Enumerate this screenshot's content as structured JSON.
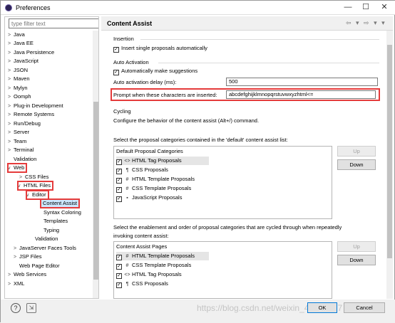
{
  "window": {
    "title": "Preferences",
    "minimize_glyph": "—",
    "maximize_glyph": "☐",
    "close_glyph": "✕"
  },
  "sidebar": {
    "filter_placeholder": "type filter text",
    "items": [
      {
        "label": "Java",
        "arrow": ">"
      },
      {
        "label": "Java EE",
        "arrow": ">"
      },
      {
        "label": "Java Persistence",
        "arrow": ">"
      },
      {
        "label": "JavaScript",
        "arrow": ">"
      },
      {
        "label": "JSON",
        "arrow": ">"
      },
      {
        "label": "Maven",
        "arrow": ">"
      },
      {
        "label": "Mylyn",
        "arrow": ">"
      },
      {
        "label": "Oomph",
        "arrow": ">"
      },
      {
        "label": "Plug-in Development",
        "arrow": ">"
      },
      {
        "label": "Remote Systems",
        "arrow": ">"
      },
      {
        "label": "Run/Debug",
        "arrow": ">"
      },
      {
        "label": "Server",
        "arrow": ">"
      },
      {
        "label": "Team",
        "arrow": ">"
      },
      {
        "label": "Terminal",
        "arrow": ">"
      },
      {
        "label": "Validation",
        "arrow": ""
      },
      {
        "label": "Web",
        "arrow": "v"
      },
      {
        "label": "CSS Files",
        "arrow": ">"
      },
      {
        "label": "HTML Files",
        "arrow": "v"
      },
      {
        "label": "Editor",
        "arrow": "v"
      },
      {
        "label": "Content Assist",
        "arrow": ""
      },
      {
        "label": "Syntax Coloring",
        "arrow": ""
      },
      {
        "label": "Templates",
        "arrow": ""
      },
      {
        "label": "Typing",
        "arrow": ""
      },
      {
        "label": "Validation",
        "arrow": ""
      },
      {
        "label": "JavaServer Faces Tools",
        "arrow": ">"
      },
      {
        "label": "JSP Files",
        "arrow": ">"
      },
      {
        "label": "Web Page Editor",
        "arrow": ""
      },
      {
        "label": "Web Services",
        "arrow": ">"
      },
      {
        "label": "XML",
        "arrow": ">"
      }
    ]
  },
  "page": {
    "title": "Content Assist",
    "nav_icons": "⇦ ▾ ⇨ ▾ ▾",
    "insertion": {
      "heading": "Insertion",
      "insert_single": "Insert single proposals automatically"
    },
    "auto_activation": {
      "heading": "Auto Activation",
      "make_suggestions": "Automatically make suggestions",
      "delay_label": "Auto activation delay (ms):",
      "delay_value": "500",
      "prompt_label": "Prompt when these characters are inserted:",
      "prompt_value": "abcdefghijklmnopqrstuvwxyzhtml<="
    },
    "cycling": {
      "heading": "Cycling",
      "description": "Configure the behavior of the content assist (Alt+/) command."
    },
    "default_list": {
      "description": "Select the proposal categories contained in the 'default' content assist list:",
      "header": "Default Proposal Categories",
      "rows": [
        {
          "icon": "<>",
          "label": "HTML Tag Proposals",
          "checked": "✓"
        },
        {
          "icon": "¶",
          "label": "CSS Proposals",
          "checked": "✓"
        },
        {
          "icon": "#",
          "label": "HTML Template Proposals",
          "checked": "✓"
        },
        {
          "icon": "#",
          "label": "CSS Template Proposals",
          "checked": "✓"
        },
        {
          "icon": "▪",
          "label": "JavaScript Proposals",
          "checked": "✓"
        }
      ],
      "up_label": "Up",
      "down_label": "Down"
    },
    "cycle_list": {
      "description_line1": "Select the enablement and order of proposal categories that are cycled through when repeatedly",
      "description_line2": "invoking content assist:",
      "header": "Content Assist Pages",
      "rows": [
        {
          "icon": "#",
          "label": "HTML Template Proposals",
          "checked": "✓"
        },
        {
          "icon": "#",
          "label": "CSS Template Proposals",
          "checked": "✓"
        },
        {
          "icon": "<>",
          "label": "HTML Tag Proposals",
          "checked": "✓"
        },
        {
          "icon": "¶",
          "label": "CSS Proposals",
          "checked": "✓"
        }
      ],
      "up_label": "Up",
      "down_label": "Down"
    }
  },
  "footer": {
    "help_glyph": "?",
    "import_glyph": "⇲",
    "ok_label": "OK",
    "cancel_label": "Cancel",
    "watermark": "https://blog.csdn.net/weixin_44599077"
  },
  "colors": {
    "highlight": "#e53b3b",
    "selection": "#cde8ff"
  }
}
